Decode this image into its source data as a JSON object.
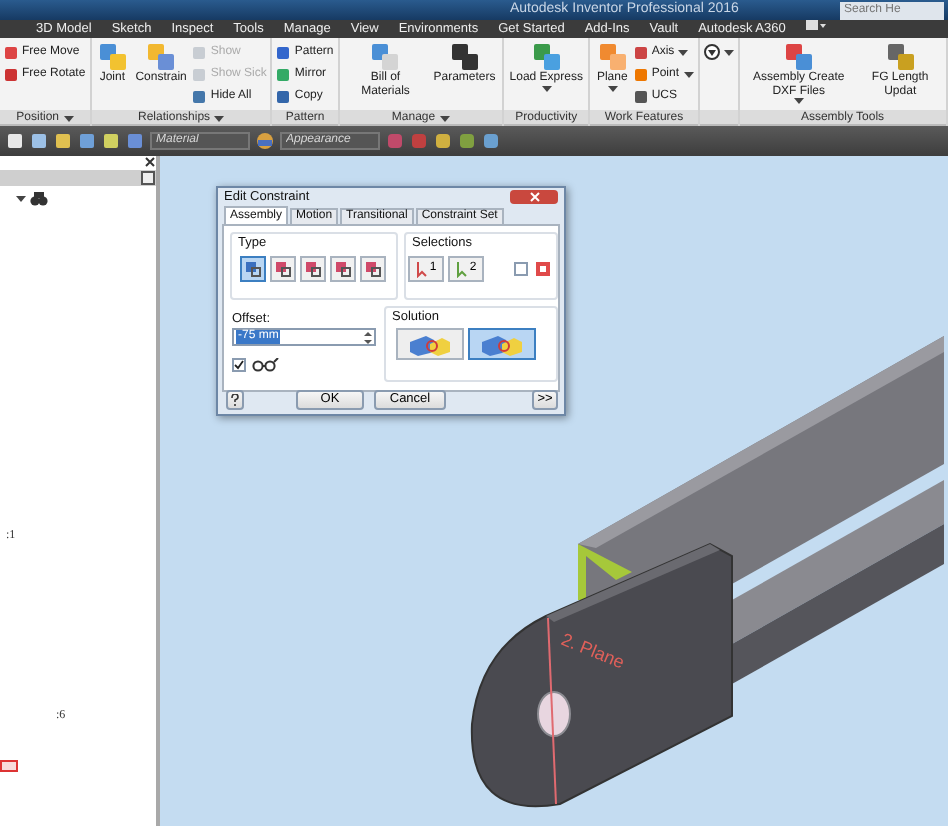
{
  "window": {
    "title": "Autodesk Inventor Professional 2016"
  },
  "search": {
    "placeholder": "Search He"
  },
  "ribbon_tabs": [
    {
      "label": "3D Model"
    },
    {
      "label": "Sketch"
    },
    {
      "label": "Inspect"
    },
    {
      "label": "Tools"
    },
    {
      "label": "Manage"
    },
    {
      "label": "View"
    },
    {
      "label": "Environments"
    },
    {
      "label": "Get Started"
    },
    {
      "label": "Add-Ins"
    },
    {
      "label": "Vault"
    },
    {
      "label": "Autodesk A360"
    }
  ],
  "ribbon_panels": [
    {
      "label": "Position",
      "dropdown": true,
      "items": [
        {
          "kind": "small",
          "label": "Free Move",
          "disabled": false,
          "dropdown": false
        },
        {
          "kind": "small",
          "label": "Free Rotate",
          "disabled": false,
          "dropdown": false
        }
      ]
    },
    {
      "label": "Relationships",
      "dropdown": true,
      "items": [
        {
          "kind": "large",
          "label": "Joint",
          "disabled": false,
          "dropdown": false
        },
        {
          "kind": "large",
          "label": "Constrain",
          "disabled": false,
          "dropdown": false
        },
        {
          "kind": "small",
          "label": "Show",
          "disabled": true,
          "dropdown": false
        },
        {
          "kind": "small",
          "label": "Show Sick",
          "disabled": true,
          "dropdown": false
        },
        {
          "kind": "small",
          "label": "Hide All",
          "disabled": false,
          "dropdown": false
        }
      ]
    },
    {
      "label": "Pattern",
      "dropdown": false,
      "items": [
        {
          "kind": "small",
          "label": "Pattern",
          "disabled": false,
          "dropdown": false
        },
        {
          "kind": "small",
          "label": "Mirror",
          "disabled": false,
          "dropdown": false
        },
        {
          "kind": "small",
          "label": "Copy",
          "disabled": false,
          "dropdown": false
        }
      ]
    },
    {
      "label": "Manage",
      "dropdown": true,
      "items": [
        {
          "kind": "large",
          "label": "Bill of Materials",
          "disabled": false,
          "dropdown": false
        },
        {
          "kind": "large",
          "label": "Parameters",
          "disabled": false,
          "dropdown": false
        }
      ]
    },
    {
      "label": "Productivity",
      "dropdown": false,
      "items": [
        {
          "kind": "large",
          "label": "Load Express",
          "disabled": false,
          "dropdown": true
        }
      ]
    },
    {
      "label": "Work Features",
      "dropdown": false,
      "items": [
        {
          "kind": "large",
          "label": "Plane",
          "disabled": false,
          "dropdown": true
        },
        {
          "kind": "small",
          "label": "Axis",
          "disabled": false,
          "dropdown": true
        },
        {
          "kind": "small",
          "label": "Point",
          "disabled": false,
          "dropdown": true
        },
        {
          "kind": "small",
          "label": "UCS",
          "disabled": false,
          "dropdown": false
        }
      ]
    },
    {
      "items": [
        {
          "kind": "icon",
          "disabled": false,
          "dropdown": true
        }
      ]
    },
    {
      "label": "Assembly Tools",
      "dropdown": false,
      "items": [
        {
          "kind": "large",
          "label": "Assembly Create DXF Files",
          "disabled": false,
          "dropdown": true
        },
        {
          "kind": "large",
          "label": "FG Length Updat",
          "disabled": false,
          "dropdown": false
        }
      ]
    }
  ],
  "quick_access": {
    "material_placeholder": "Material",
    "appearance_placeholder": "Appearance"
  },
  "browser": {
    "texts": [
      ":1",
      ":6"
    ]
  },
  "viewport": {
    "label": "2. Plane"
  },
  "dialog": {
    "title": "Edit Constraint",
    "tabs": [
      {
        "label": "Assembly",
        "selected": true
      },
      {
        "label": "Motion",
        "selected": false
      },
      {
        "label": "Transitional",
        "selected": false
      },
      {
        "label": "Constraint Set",
        "selected": false
      }
    ],
    "type_label": "Type",
    "type_buttons": [
      {
        "selected": true
      },
      {
        "selected": false
      },
      {
        "selected": false
      },
      {
        "selected": false
      },
      {
        "selected": false
      }
    ],
    "selections_label": "Selections",
    "selection_buttons": [
      "1",
      "2"
    ],
    "pick_part_first_checked": false,
    "offset_label": "Offset:",
    "offset_value": "-75 mm",
    "show_preview_checked": true,
    "solution_label": "Solution",
    "solution_buttons": [
      {
        "selected": false
      },
      {
        "selected": true
      }
    ],
    "buttons": [
      "OK",
      "Cancel",
      ">>"
    ]
  }
}
